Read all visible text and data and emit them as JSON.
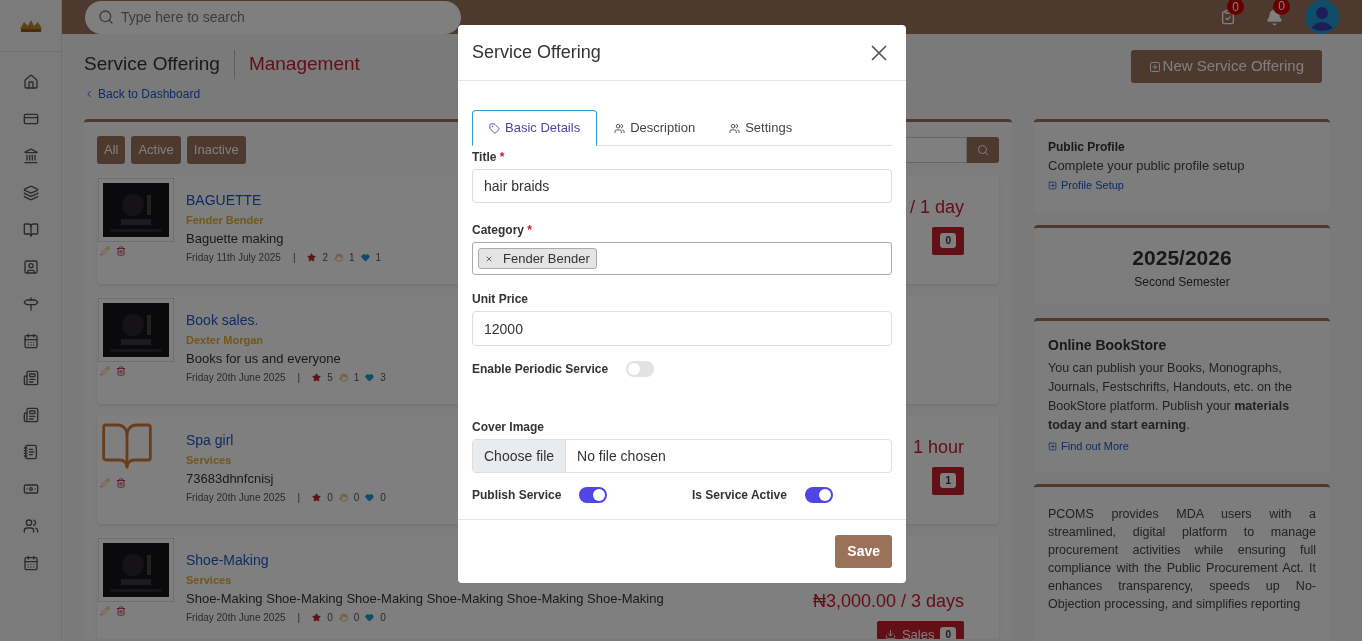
{
  "header": {
    "search_placeholder": "Type here to search",
    "task_count": "0",
    "notification_count": "0"
  },
  "page": {
    "title": "Service Offering",
    "subtitle": "Management",
    "back_link": "Back to Dashboard",
    "new_button": "New Service Offering"
  },
  "filters": [
    "All",
    "Active",
    "Inactive"
  ],
  "services": [
    {
      "kind": "picture",
      "title": "BAGUETTE",
      "category": "Fender Bender",
      "description": "Baguette making",
      "date": "Friday 11th July 2025",
      "separator": "|",
      "star_count": "2",
      "like_count": "1",
      "heart_count": "1",
      "price": "/ 1 day",
      "sales_count": "0"
    },
    {
      "kind": "picture",
      "title": "Book sales.",
      "category": "Dexter Morgan",
      "description": "Books for us and everyone",
      "date": "Friday 20th June 2025",
      "separator": "|",
      "star_count": "5",
      "like_count": "1",
      "heart_count": "3"
    },
    {
      "kind": "book",
      "title": "Spa girl",
      "category": "Services",
      "description": "73683dhnfcnisj",
      "date": "Friday 20th June 2025",
      "separator": "|",
      "star_count": "0",
      "like_count": "0",
      "heart_count": "0",
      "price": "1 hour",
      "sales_count": "1"
    },
    {
      "kind": "picture",
      "title": "Shoe-Making",
      "category": "Services",
      "description": "Shoe-Making Shoe-Making Shoe-Making Shoe-Making Shoe-Making Shoe-Making",
      "date": "Friday 20th June 2025",
      "separator": "|",
      "star_count": "0",
      "like_count": "0",
      "heart_count": "0",
      "price": "₦3,000.00 / 3 days",
      "sales_label": "Sales",
      "sales_count": "0"
    }
  ],
  "side_cards": {
    "profile": {
      "title": "Public Profile",
      "text": "Complete your public profile setup",
      "link": "Profile Setup"
    },
    "session": {
      "year": "2025/2026",
      "semester": "Second Semester"
    },
    "bookstore": {
      "title": "Online BookStore",
      "text": "You can publish your Books, Monographs, Journals, Festschrifts, Handouts, etc. on the BookStore platform. Publish your **materials today and start earning**.",
      "link": "Find out More"
    },
    "pcoms": {
      "text": "PCOMS provides MDA users with a streamlined, digital platform to manage procurement activities while ensuring full compliance with the Public Procurement Act. It enhances transparency, speeds up No-Objection processing, and simplifies reporting"
    }
  },
  "modal": {
    "title": "Service Offering",
    "tabs": [
      {
        "label": "Basic Details",
        "selected": true
      },
      {
        "label": "Description",
        "selected": false
      },
      {
        "label": "Settings",
        "selected": false
      }
    ],
    "title_label": "Title",
    "title_required": "*",
    "title_value": "hair braids",
    "category_label": "Category",
    "category_required": "*",
    "category_tags": [
      "Fender Bender"
    ],
    "price_label": "Unit Price",
    "price_value": "12000",
    "periodic": {
      "label": "Enable Periodic Service",
      "on": false
    },
    "cover_label": "Cover Image",
    "file_button": "Choose file",
    "file_status": "No file chosen",
    "publish": {
      "label": "Publish Service",
      "on": true
    },
    "active": {
      "label": "Is Service Active",
      "on": true
    },
    "save": "Save"
  }
}
